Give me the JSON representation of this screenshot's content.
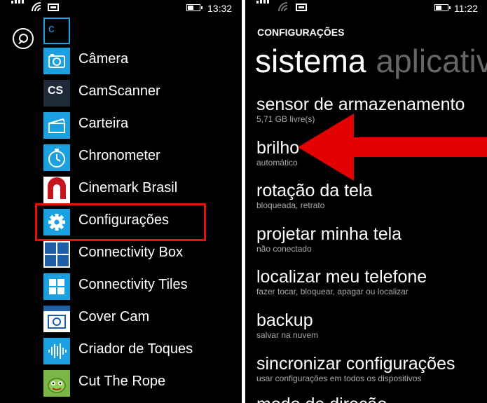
{
  "left_phone": {
    "status": {
      "time": "13:32"
    },
    "group_letter": "c",
    "apps": [
      {
        "label": "Câmera",
        "icon": "camera-icon"
      },
      {
        "label": "CamScanner",
        "icon": "camscanner-icon",
        "icon_text": "CS"
      },
      {
        "label": "Carteira",
        "icon": "wallet-icon"
      },
      {
        "label": "Chronometer",
        "icon": "stopwatch-icon"
      },
      {
        "label": "Cinemark Brasil",
        "icon": "cinemark-icon"
      },
      {
        "label": "Configurações",
        "icon": "gear-icon"
      },
      {
        "label": "Connectivity Box",
        "icon": "connectivity-box-icon"
      },
      {
        "label": "Connectivity Tiles",
        "icon": "tiles-icon"
      },
      {
        "label": "Cover Cam",
        "icon": "cover-cam-icon"
      },
      {
        "label": "Criador de Toques",
        "icon": "waveform-icon"
      },
      {
        "label": "Cut The Rope",
        "icon": "cut-the-rope-icon"
      }
    ]
  },
  "right_phone": {
    "status": {
      "time": "11:22"
    },
    "header": "CONFIGURAÇÕES",
    "pivot": {
      "active": "sistema",
      "inactive": "aplicativos"
    },
    "settings": [
      {
        "title": "sensor de armazenamento",
        "subtitle": "5,71 GB livre(s)"
      },
      {
        "title": "brilho",
        "subtitle": "automático"
      },
      {
        "title": "rotação da tela",
        "subtitle": "bloqueada, retrato"
      },
      {
        "title": "projetar minha tela",
        "subtitle": "não conectado"
      },
      {
        "title": "localizar meu telefone",
        "subtitle": "fazer tocar, bloquear, apagar ou localizar"
      },
      {
        "title": "backup",
        "subtitle": "salvar na nuvem"
      },
      {
        "title": "sincronizar configurações",
        "subtitle": "usar configurações em todos os dispositivos"
      },
      {
        "title": "modo de direção",
        "subtitle": ""
      }
    ]
  },
  "colors": {
    "accent": "#1ba1e2",
    "highlight": "#e51400",
    "background": "#000000"
  }
}
